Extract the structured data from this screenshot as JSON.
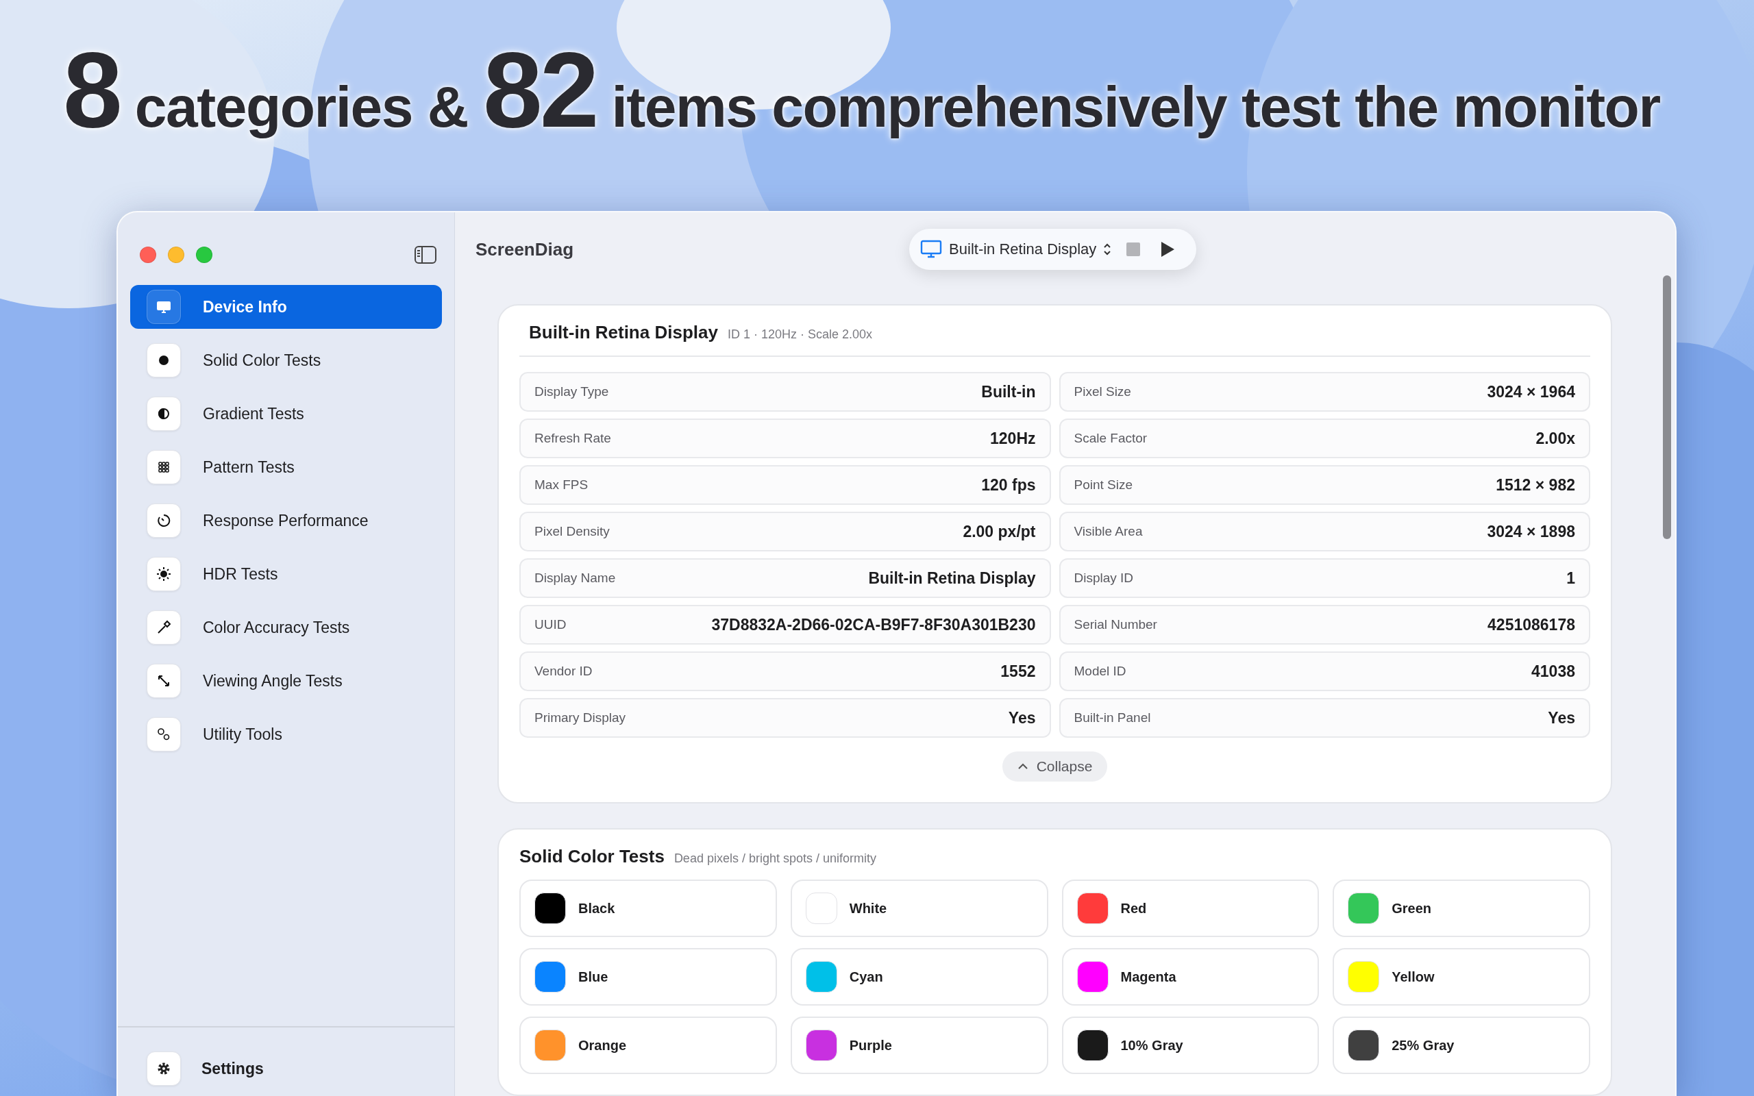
{
  "headline": [
    {
      "text": "8",
      "emphasis": true
    },
    {
      "text": "categories &",
      "emphasis": false
    },
    {
      "text": "82",
      "emphasis": true
    },
    {
      "text": "items comprehensively test the monitor",
      "emphasis": false
    }
  ],
  "sidebar": {
    "items": [
      {
        "label": "Device Info",
        "selected": true
      },
      {
        "label": "Solid Color Tests",
        "selected": false
      },
      {
        "label": "Gradient Tests",
        "selected": false
      },
      {
        "label": "Pattern Tests",
        "selected": false
      },
      {
        "label": "Response Performance",
        "selected": false
      },
      {
        "label": "HDR Tests",
        "selected": false
      },
      {
        "label": "Color Accuracy Tests",
        "selected": false
      },
      {
        "label": "Viewing Angle Tests",
        "selected": false
      },
      {
        "label": "Utility Tools",
        "selected": false
      }
    ],
    "footer": {
      "label": "Settings"
    }
  },
  "window": {
    "title": "ScreenDiag"
  },
  "toolbar": {
    "display_picker": "Built-in Retina Display"
  },
  "device_card": {
    "title": "Built-in Retina Display",
    "subtitle": "ID 1 · 120Hz · Scale 2.00x",
    "fields": [
      {
        "label": "Display Type",
        "value": "Built-in"
      },
      {
        "label": "Pixel Size",
        "value": "3024 × 1964"
      },
      {
        "label": "Refresh Rate",
        "value": "120Hz"
      },
      {
        "label": "Scale Factor",
        "value": "2.00x"
      },
      {
        "label": "Max FPS",
        "value": "120 fps"
      },
      {
        "label": "Point Size",
        "value": "1512 × 982"
      },
      {
        "label": "Pixel Density",
        "value": "2.00 px/pt"
      },
      {
        "label": "Visible Area",
        "value": "3024 × 1898"
      },
      {
        "label": "Display Name",
        "value": "Built-in Retina Display"
      },
      {
        "label": "Display ID",
        "value": "1"
      },
      {
        "label": "UUID",
        "value": "37D8832A-2D66-02CA-B9F7-8F30A301B230"
      },
      {
        "label": "Serial Number",
        "value": "4251086178"
      },
      {
        "label": "Vendor ID",
        "value": "1552"
      },
      {
        "label": "Model ID",
        "value": "41038"
      },
      {
        "label": "Primary Display",
        "value": "Yes"
      },
      {
        "label": "Built-in Panel",
        "value": "Yes"
      }
    ],
    "collapse_button": "Collapse"
  },
  "solid_card": {
    "title": "Solid Color Tests",
    "subtitle": "Dead pixels / bright spots / uniformity",
    "tiles": [
      {
        "label": "Black",
        "color": "#000000"
      },
      {
        "label": "White",
        "color": "#ffffff"
      },
      {
        "label": "Red",
        "color": "#ff3b3b"
      },
      {
        "label": "Green",
        "color": "#34c759"
      },
      {
        "label": "Blue",
        "color": "#0a84ff"
      },
      {
        "label": "Cyan",
        "color": "#00c0e8"
      },
      {
        "label": "Magenta",
        "color": "#ff00ff"
      },
      {
        "label": "Yellow",
        "color": "#ffff00"
      },
      {
        "label": "Orange",
        "color": "#ff922b"
      },
      {
        "label": "Purple",
        "color": "#c830e0"
      },
      {
        "label": "10% Gray",
        "color": "#1a1a1a"
      },
      {
        "label": "25% Gray",
        "color": "#404040"
      }
    ]
  }
}
